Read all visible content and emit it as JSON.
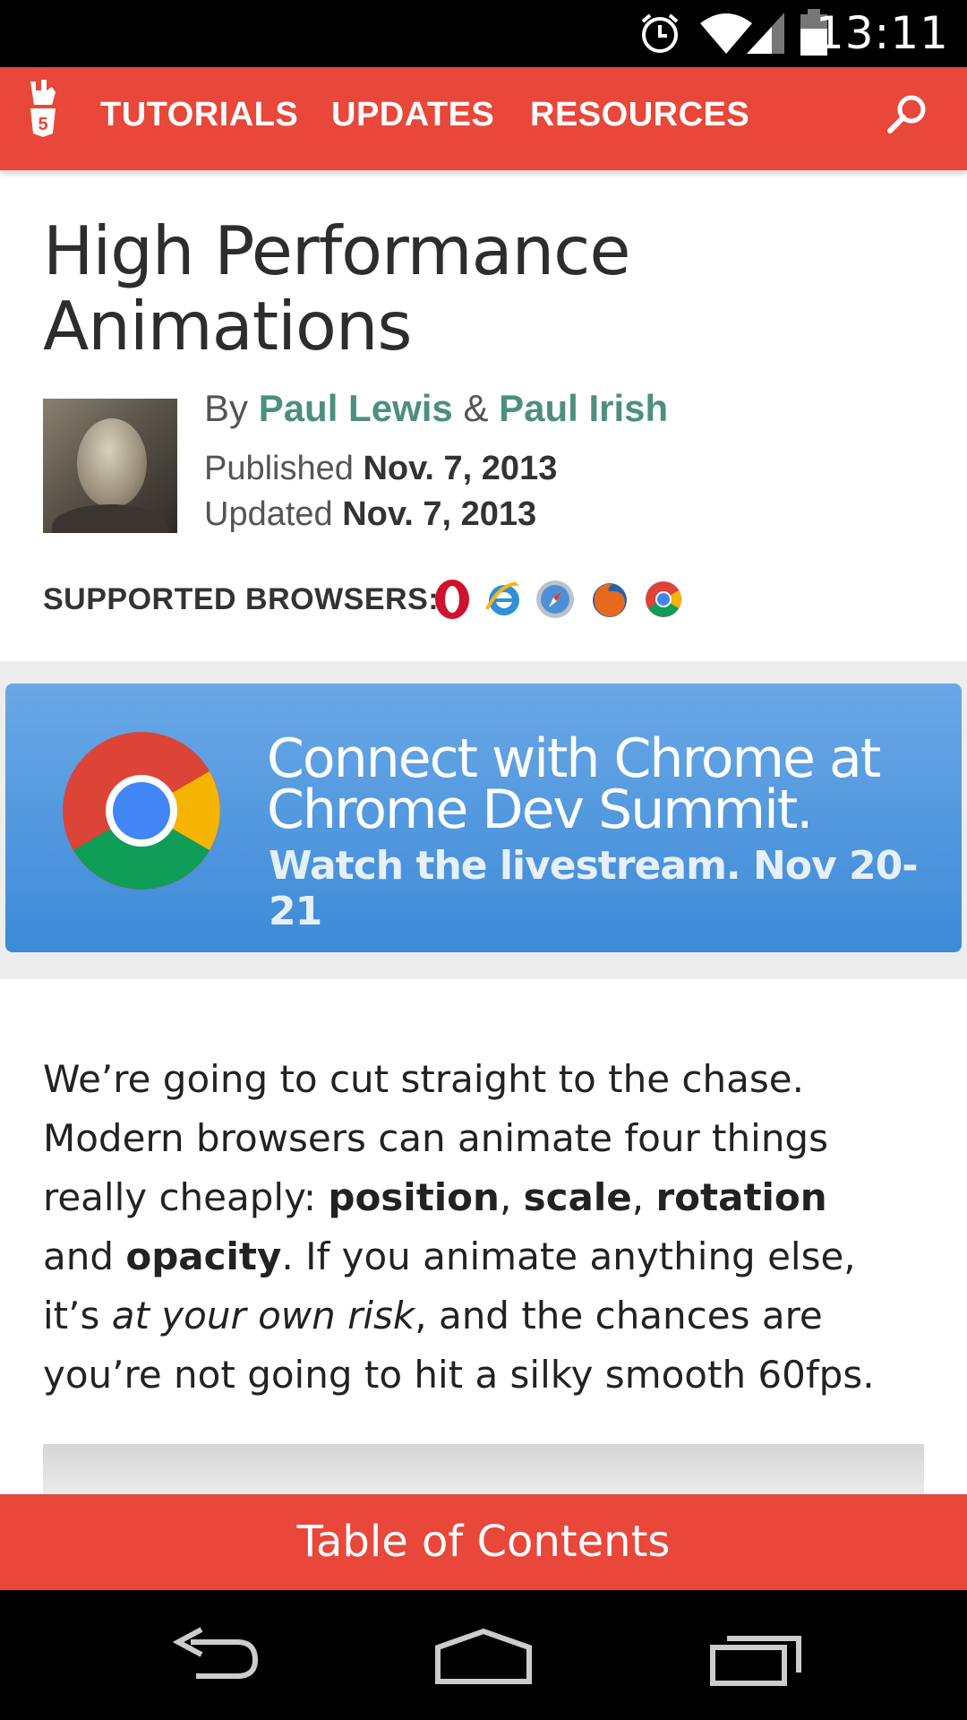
{
  "status_bar": {
    "time": "13:11"
  },
  "nav": {
    "items": [
      "TUTORIALS",
      "UPDATES",
      "RESOURCES"
    ]
  },
  "article": {
    "title_line1": "High Performance",
    "title_line2": "Animations",
    "by_label": "By",
    "author1": "Paul Lewis",
    "amp": "&",
    "author2": "Paul Irish",
    "published_label": "Published",
    "published_date": "Nov. 7, 2013",
    "updated_label": "Updated",
    "updated_date": "Nov. 7, 2013",
    "supported_label": "SUPPORTED BROWSERS:",
    "browsers": [
      "opera-icon",
      "ie-icon",
      "safari-icon",
      "firefox-icon",
      "chrome-icon"
    ]
  },
  "banner": {
    "line1": "Connect with Chrome at",
    "line2": "Chrome Dev Summit.",
    "line3": "Watch the livestream. Nov 20-21"
  },
  "body": {
    "t1": "We’re going to cut straight to the chase. Modern browsers can animate four things really cheaply: ",
    "b1": "position",
    "c1": ", ",
    "b2": "scale",
    "c2": ", ",
    "b3": "rotation",
    "t2": " and ",
    "b4": "opacity",
    "t3": ". If you animate anything else, it’s ",
    "i1": "at your own risk",
    "t4": ", and the chances are you’re not going to hit a silky smooth 60fps."
  },
  "toc": {
    "label": "Table of Contents"
  },
  "colors": {
    "accent": "#e8473a",
    "link": "#4c8f80",
    "banner": "#4a90dc"
  }
}
